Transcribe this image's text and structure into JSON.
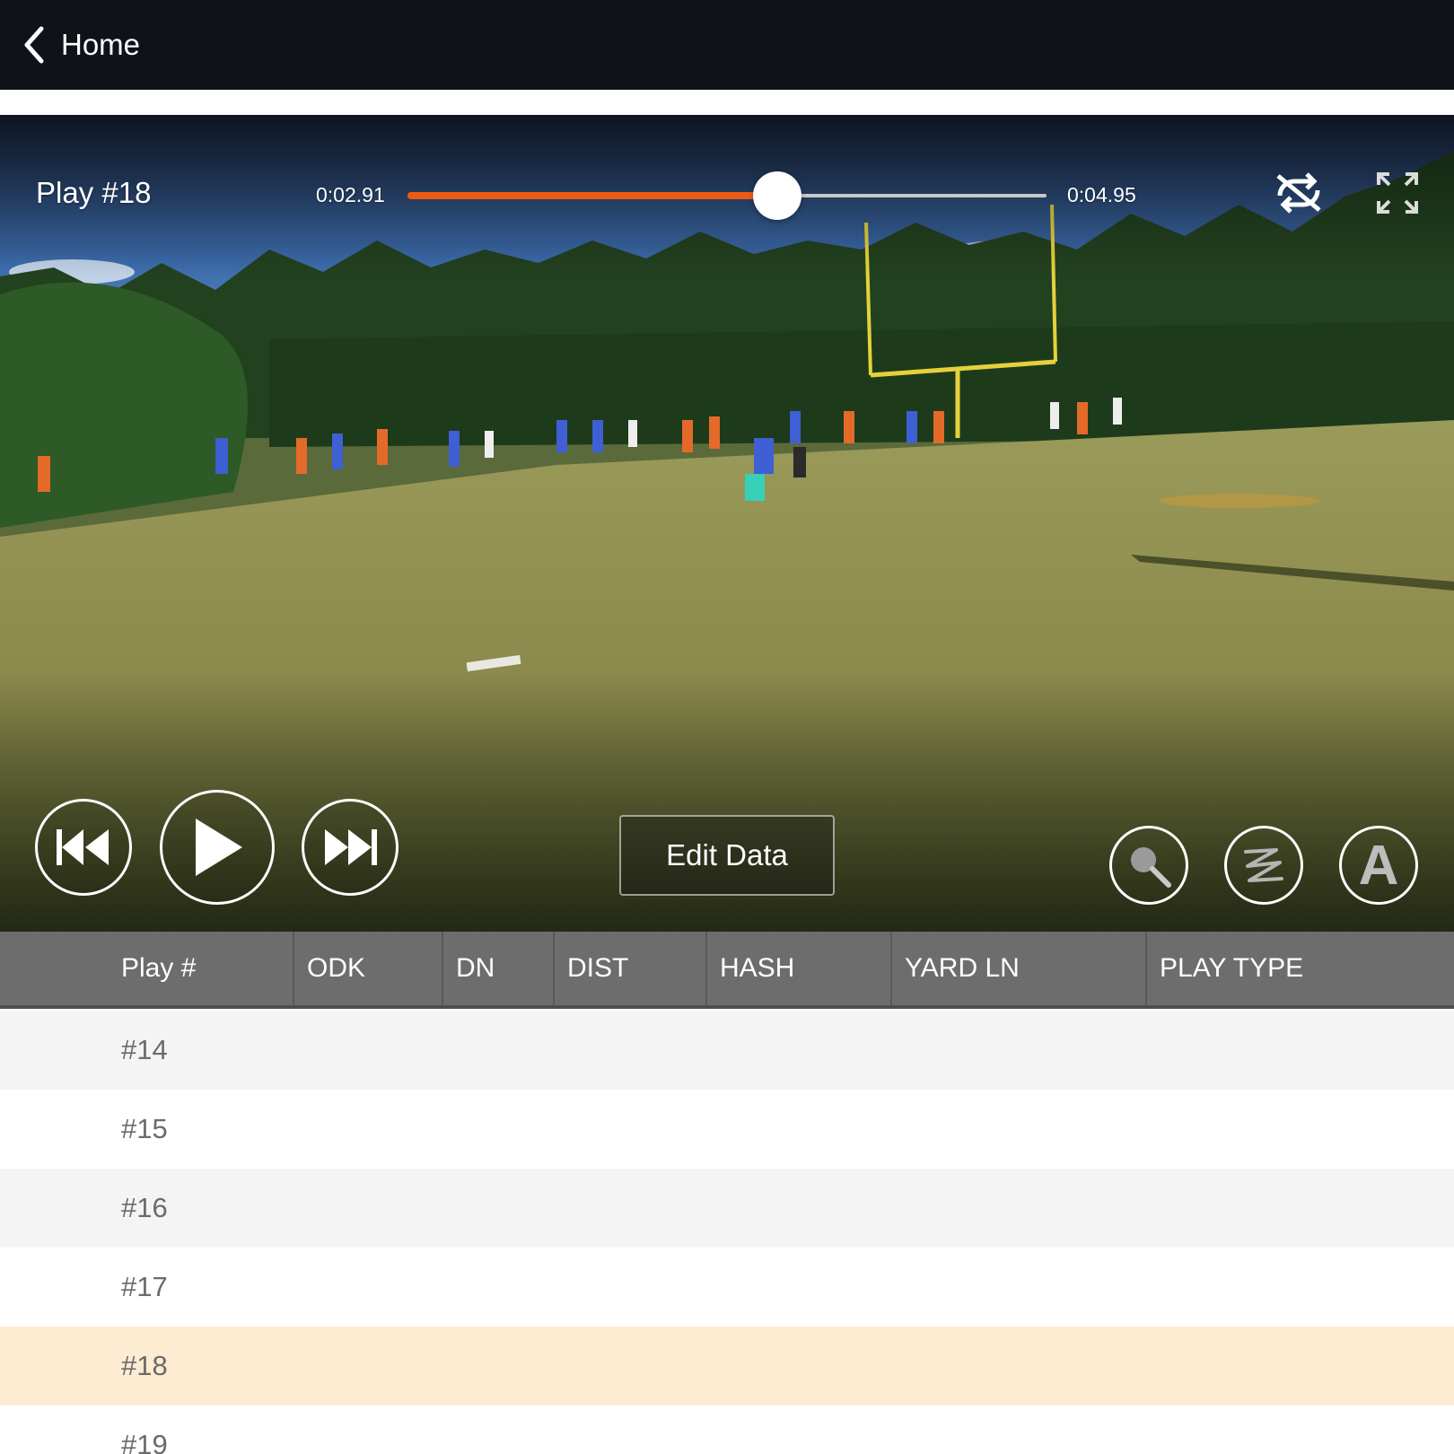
{
  "nav": {
    "back_label": "Home"
  },
  "player": {
    "play_title": "Play #18",
    "current_time": "0:02.91",
    "total_time": "0:04.95",
    "progress_fraction": 0.578,
    "accent_color": "#ee5a14",
    "controls": {
      "prev_icon": "skip-previous-icon",
      "play_icon": "play-icon",
      "next_icon": "skip-next-icon",
      "loop_icon": "loop-off-icon",
      "fullscreen_icon": "fullscreen-icon"
    },
    "edit_data_label": "Edit Data",
    "tools": {
      "zoom_icon": "magnifier-icon",
      "draw_icon": "scribble-icon",
      "text_label": "A"
    }
  },
  "table": {
    "columns": [
      "Play #",
      "ODK",
      "DN",
      "DIST",
      "HASH",
      "YARD LN",
      "PLAY TYPE"
    ],
    "rows": [
      {
        "play": "#14"
      },
      {
        "play": "#15"
      },
      {
        "play": "#16"
      },
      {
        "play": "#17"
      },
      {
        "play": "#18",
        "selected": true
      },
      {
        "play": "#19"
      }
    ],
    "selected_row_color": "#fdebd2"
  }
}
